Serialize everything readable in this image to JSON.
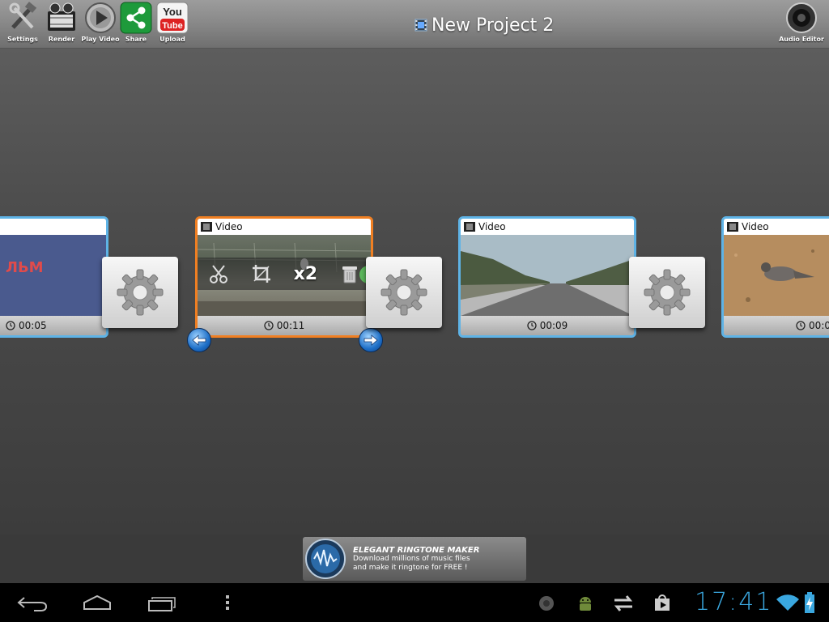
{
  "toolbar": {
    "items": [
      {
        "label": "Settings",
        "icon": "tools-icon"
      },
      {
        "label": "Render",
        "icon": "film-reel-icon"
      },
      {
        "label": "Play Video",
        "icon": "play-icon"
      },
      {
        "label": "Share",
        "icon": "share-icon"
      },
      {
        "label": "Upload",
        "icon": "youtube-icon"
      }
    ],
    "youtube_you": "You",
    "youtube_tube": "Tube",
    "project_title": "New Project 2",
    "audio_editor_label": "Audio Editor"
  },
  "timeline": {
    "clips": [
      {
        "type_label": "",
        "duration": "00:05",
        "thumb_text": "ЛЬМ",
        "selected": false
      },
      {
        "type_label": "Video",
        "duration": "00:11",
        "selected": true
      },
      {
        "type_label": "Video",
        "duration": "00:09",
        "selected": false
      },
      {
        "type_label": "Video",
        "duration": "00:0",
        "selected": false
      }
    ],
    "clip_actions": {
      "speed_label": "x2"
    }
  },
  "ad": {
    "title": "ELEGANT RINGTONE MAKER",
    "line1": "Download millions of music files",
    "line2": "and make it ringtone for FREE !"
  },
  "system_bar": {
    "clock": "17:41"
  },
  "colors": {
    "selected_border": "#f07f22",
    "clip_border": "#5eb3e6",
    "clock": "#3aa7df"
  }
}
